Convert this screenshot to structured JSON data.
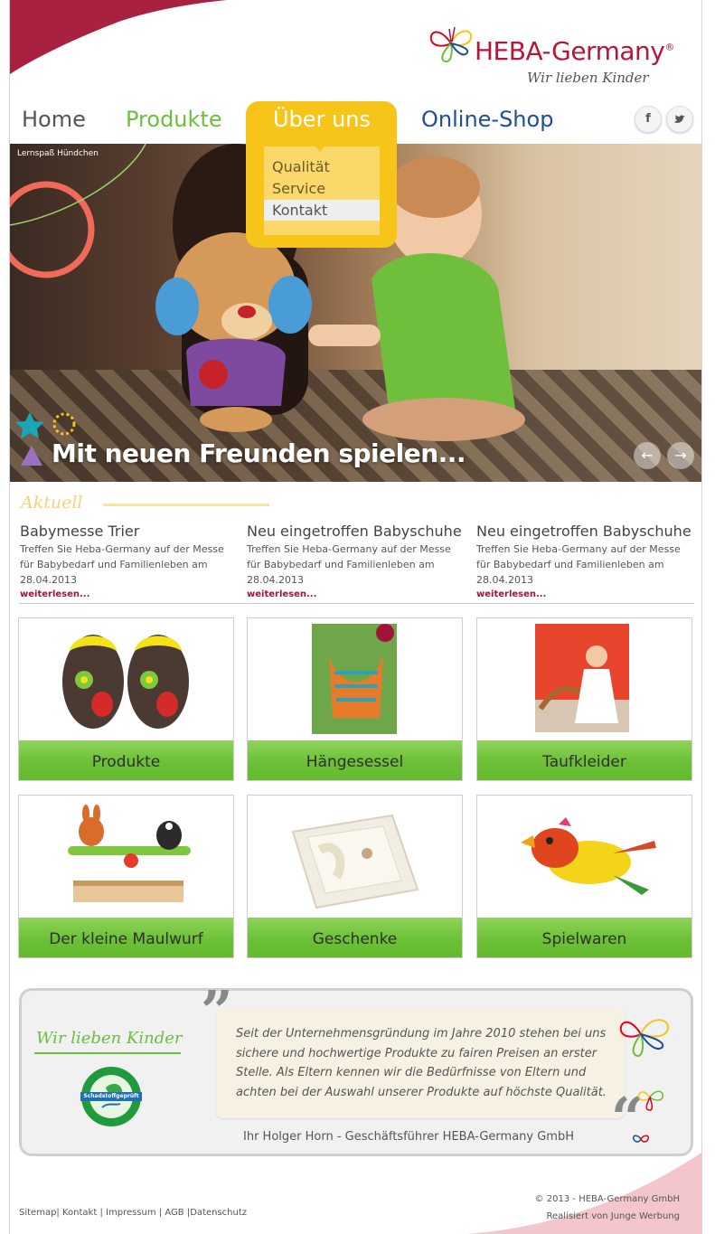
{
  "brand": {
    "name": "HEBA-Germany",
    "registered": "®",
    "tagline": "Wir lieben Kinder",
    "colors": {
      "red": "#b5173a",
      "green": "#6cbf3d",
      "yellow": "#f7c51a",
      "blue": "#1d4e97"
    }
  },
  "nav": {
    "home": "Home",
    "produkte": "Produkte",
    "ueber_uns": "Über uns",
    "shop": "Online-Shop",
    "dropdown": [
      "Qualität",
      "Service",
      "Kontakt"
    ],
    "dropdown_active": "Kontakt"
  },
  "social": {
    "facebook": "f",
    "twitter": "🐦"
  },
  "hero": {
    "label": "Lernspaß Hündchen",
    "caption": "Mit neuen Freunden spielen...",
    "prev": "←",
    "next": "→"
  },
  "aktuell": {
    "title": "Aktuell",
    "items": [
      {
        "title": "Babymesse Trier",
        "text": "Treffen Sie Heba-Germany auf der Messe für Babybedarf und Familienleben am 28.04.2013",
        "more": "weiterlesen..."
      },
      {
        "title": "Neu eingetroffen Babyschuhe",
        "text": "Treffen Sie Heba-Germany auf der Messe für Babybedarf und Familienleben am 28.04.2013",
        "more": "weiterlesen..."
      },
      {
        "title": "Neu eingetroffen Babyschuhe",
        "text": "Treffen Sie Heba-Germany auf der Messe für Babybedarf und Familienleben am 28.04.2013",
        "more": "weiterlesen..."
      }
    ]
  },
  "tiles": [
    {
      "label": "Produkte",
      "icon": "baby-shoes-image"
    },
    {
      "label": "Hängesessel",
      "icon": "hanging-chair-image"
    },
    {
      "label": "Taufkleider",
      "icon": "christening-dress-image"
    },
    {
      "label": "Der kleine Maulwurf",
      "icon": "mole-coat-rack-image"
    },
    {
      "label": "Geschenke",
      "icon": "gift-box-image"
    },
    {
      "label": "Spielwaren",
      "icon": "wooden-bird-toy-image"
    }
  ],
  "about": {
    "title": "Wir lieben Kinder",
    "seal": "Schadstoffgeprüft",
    "quote": "Seit der Unternehmensgründung im Jahre 2010 stehen bei uns sichere und hochwertige Produkte zu fairen Preisen an erster Stelle. Als Eltern kennen wir die Bedürfnisse von Eltern und achten bei der Auswahl unserer Produkte auf höchste Qualität.",
    "quote_open": "”",
    "quote_close": "“",
    "signature": "Ihr Holger Horn - Geschäftsführer HEBA-Germany GmbH"
  },
  "footer": {
    "links": [
      "Sitemap",
      "Kontakt",
      "Impressum",
      "AGB",
      "Datenschutz"
    ],
    "separator": "|",
    "copyright": "© 2013 - HEBA-Germany GmbH",
    "credit": "Realisiert von Junge Werbung"
  }
}
